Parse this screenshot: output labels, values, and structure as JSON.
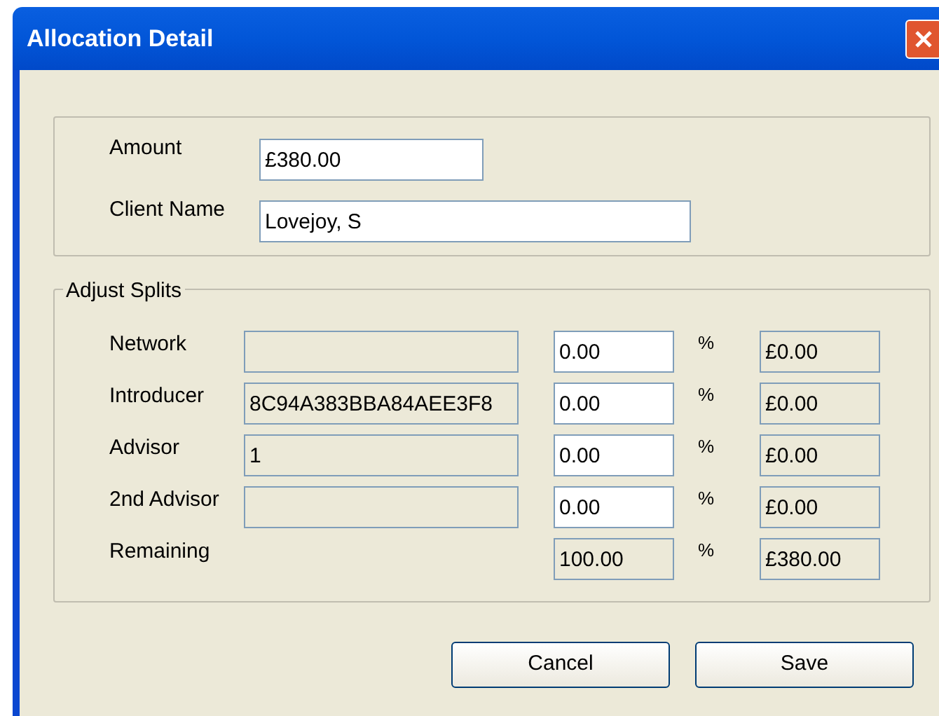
{
  "window": {
    "title": "Allocation Detail"
  },
  "details": [
    {
      "label": "Amount",
      "value": "£380.00",
      "wide": false
    },
    {
      "label": "Client Name",
      "value": "Lovejoy, S",
      "wide": true
    }
  ],
  "adjust_splits": {
    "title": "Adjust Splits",
    "rows": [
      {
        "label": "Network",
        "name": {
          "disabled": true
        },
        "percent": {
          "value": "0.00",
          "disabled": false
        },
        "unit": "%",
        "amount": {
          "value": "£0.00",
          "disabled": true
        }
      },
      {
        "label": "Introducer",
        "name": {
          "value": "8C94A383BBA84AEE3F8",
          "disabled": true
        },
        "percent": {
          "value": "0.00",
          "disabled": false
        },
        "unit": "%",
        "amount": {
          "value": "£0.00",
          "disabled": true
        }
      },
      {
        "label": "Advisor",
        "name": {
          "value": "1",
          "disabled": true
        },
        "percent": {
          "value": "0.00",
          "disabled": false
        },
        "unit": "%",
        "amount": {
          "value": "£0.00",
          "disabled": true
        }
      },
      {
        "label": "2nd Advisor",
        "name": {
          "disabled": true
        },
        "percent": {
          "value": "0.00",
          "disabled": false
        },
        "unit": "%",
        "amount": {
          "value": "£0.00",
          "disabled": true
        }
      },
      {
        "label": "Remaining",
        "percent": {
          "value": "100.00",
          "disabled": true
        },
        "unit": "%",
        "amount": {
          "value": "£380.00",
          "disabled": true
        }
      }
    ]
  },
  "buttons": [
    "Cancel",
    "Save"
  ]
}
